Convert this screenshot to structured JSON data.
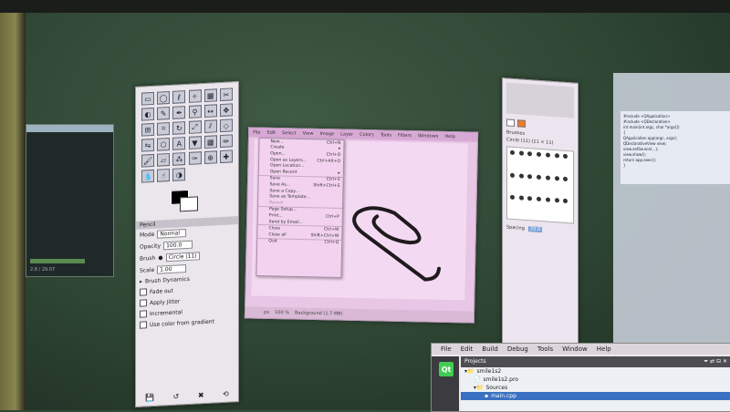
{
  "image_window": {
    "menu": [
      "File",
      "Edit",
      "Select",
      "View",
      "Image",
      "Layer",
      "Colors",
      "Tools",
      "Filters",
      "Windows",
      "Help"
    ],
    "status": {
      "unit": "px",
      "zoom": "100 %",
      "layer": "Background (1.7 MB)"
    }
  },
  "file_menu": {
    "items": [
      {
        "label": "New...",
        "shortcut": "Ctrl+N"
      },
      {
        "label": "Create",
        "shortcut": ""
      },
      {
        "label": "Open...",
        "shortcut": "Ctrl+O"
      },
      {
        "label": "Open as Layers...",
        "shortcut": "Ctrl+Alt+O"
      },
      {
        "label": "Open Location...",
        "shortcut": ""
      },
      {
        "label": "Open Recent",
        "shortcut": ""
      },
      {
        "label": "Save",
        "shortcut": "Ctrl+S"
      },
      {
        "label": "Save As...",
        "shortcut": "Shift+Ctrl+S"
      },
      {
        "label": "Save a Copy...",
        "shortcut": ""
      },
      {
        "label": "Save as Template...",
        "shortcut": ""
      },
      {
        "label": "Revert",
        "shortcut": ""
      },
      {
        "label": "Page Setup...",
        "shortcut": ""
      },
      {
        "label": "Print...",
        "shortcut": "Ctrl+P"
      },
      {
        "label": "Send by Email...",
        "shortcut": ""
      },
      {
        "label": "Close",
        "shortcut": "Ctrl+W"
      },
      {
        "label": "Close all",
        "shortcut": "Shift+Ctrl+W"
      },
      {
        "label": "Quit",
        "shortcut": "Ctrl+Q"
      }
    ]
  },
  "toolbox": {
    "options_title": "Pencil",
    "mode_label": "Mode",
    "mode_value": "Normal",
    "opacity_label": "Opacity",
    "opacity_value": "100.0",
    "brush_label": "Brush",
    "brush_value": "Circle (11)",
    "scale_label": "Scale",
    "scale_value": "1.00",
    "dynamics": "Brush Dynamics",
    "options": [
      "Fade out",
      "Apply Jitter",
      "Incremental",
      "Use color from gradient"
    ]
  },
  "dock": {
    "brushes_title": "Brushes",
    "brush_info": "Circle (11) (11 × 11)",
    "spacing_label": "Spacing",
    "spacing_value": "20.0"
  },
  "qt_creator": {
    "menu": [
      "File",
      "Edit",
      "Build",
      "Debug",
      "Tools",
      "Window",
      "Help"
    ],
    "panel_title": "Projects",
    "logo": "Qt",
    "tree": [
      "smile1s2",
      "smile1s2.pro",
      "Sources",
      "main.cpp"
    ]
  },
  "left_window": {
    "label": "2.8 / 29.07"
  },
  "code": {
    "lines": [
      "#include <QApplication>",
      "#include <QDeclarative>",
      "int main(int argc, char *argv[])",
      "{",
      "  QApplication app(argc, argv);",
      "  QDeclarativeView view;",
      "  view.setSource(...);",
      "  view.show();",
      "  return app.exec();",
      "}"
    ]
  }
}
